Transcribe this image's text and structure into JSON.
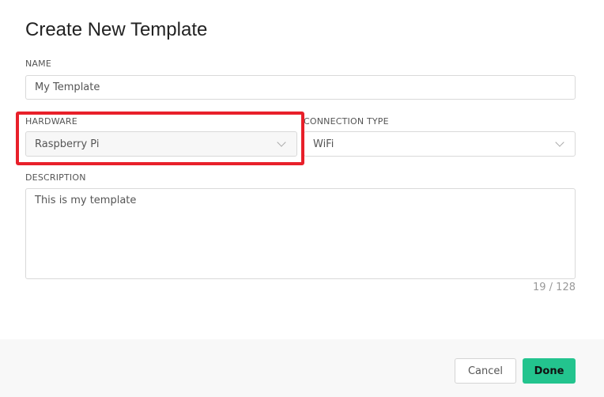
{
  "dialog": {
    "title": "Create New Template"
  },
  "name": {
    "label": "NAME",
    "value": "My Template"
  },
  "hardware": {
    "label": "HARDWARE",
    "value": "Raspberry Pi"
  },
  "connection": {
    "label": "CONNECTION TYPE",
    "value": "WiFi"
  },
  "description": {
    "label": "DESCRIPTION",
    "value": "This is my template",
    "counter": "19 / 128"
  },
  "footer": {
    "cancel": "Cancel",
    "done": "Done"
  },
  "colors": {
    "accent": "#23c48e",
    "highlight": "#e8202a"
  }
}
